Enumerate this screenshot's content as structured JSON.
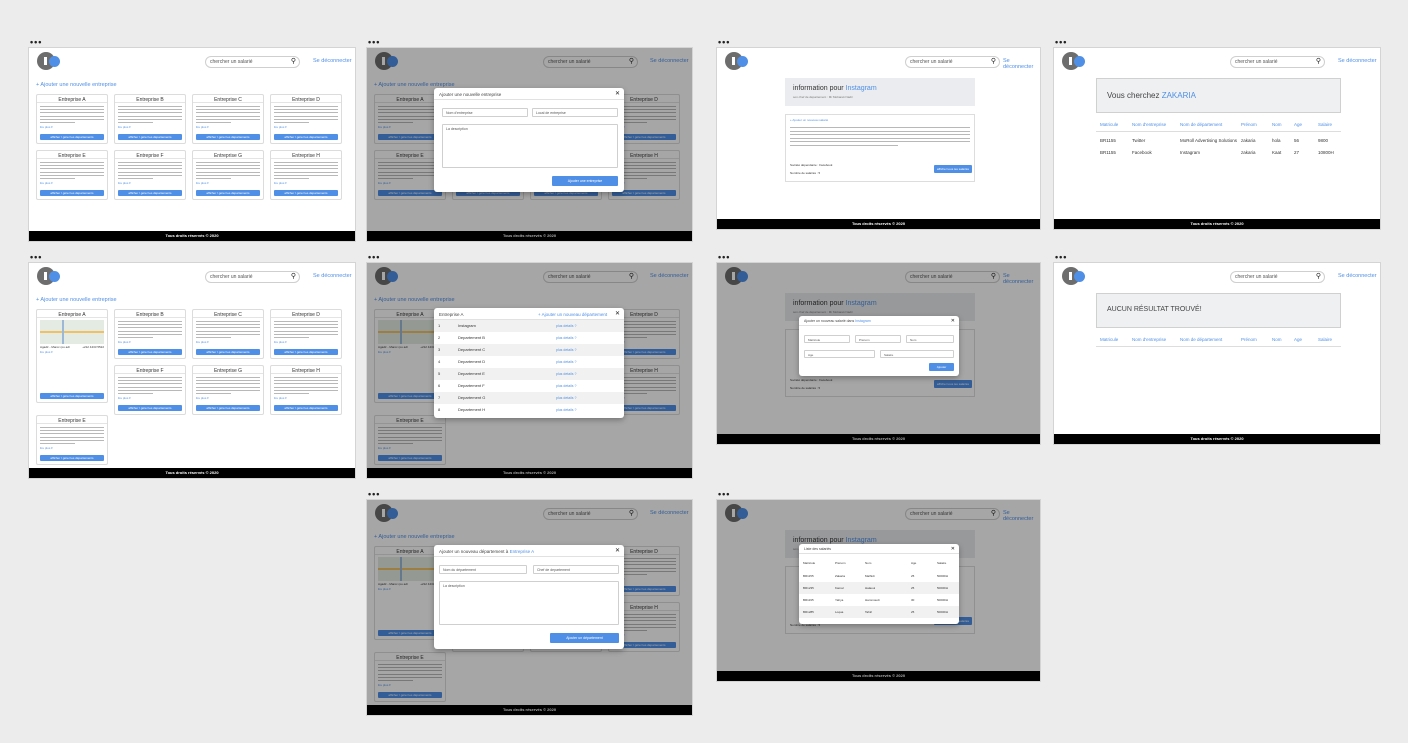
{
  "header": {
    "search_placeholder": "chercher un salarié",
    "logout": "Se déconnecter"
  },
  "footer": "Tous droits réservés © 2020",
  "dots": "•••",
  "add_company": "+ Ajouter une nouvelle entreprise",
  "companies": [
    "Entreprise A",
    "Entreprise B",
    "Entreprise C",
    "Entreprise D",
    "Entreprise E",
    "Entreprise F",
    "Entreprise G",
    "Entreprise H"
  ],
  "card_more": "lire plus ▾",
  "card_button": "afficher / gérer les départements",
  "map_caption": "Agadir - Maroc (ou adr",
  "map_phone": "+212 4433 5522",
  "modal_add_company": {
    "title": "Ajouter une nouvelle entreprise",
    "name": "Nom d'entreprise",
    "location": "Local de entreprise",
    "description": "La description",
    "button": "Ajouter une entreprise"
  },
  "modal_departments": {
    "title": "Entreprise A",
    "add": "+ Ajouter un nouveau département",
    "rows": [
      {
        "n": "1",
        "name": "Instagram",
        "link": "plus details ?"
      },
      {
        "n": "2",
        "name": "Departement B",
        "link": "plus details ?"
      },
      {
        "n": "3",
        "name": "Departement C",
        "link": "plus details ?"
      },
      {
        "n": "4",
        "name": "Departement D",
        "link": "plus details ?"
      },
      {
        "n": "5",
        "name": "Departement E",
        "link": "plus details ?"
      },
      {
        "n": "6",
        "name": "Departement F",
        "link": "plus details ?"
      },
      {
        "n": "7",
        "name": "Departement G",
        "link": "plus details ?"
      },
      {
        "n": "8",
        "name": "Departement H",
        "link": "plus details ?"
      }
    ]
  },
  "modal_add_dept": {
    "title_prefix": "Ajouter un nouveau département à ",
    "title_company": "Entreprise A",
    "name": "Nom du département",
    "chief": "Chef de departement",
    "description": "La description",
    "button": "Ajouter un département"
  },
  "info": {
    "prefix": "information pour ",
    "name": "Instagram",
    "sub": "son chef de département : Mr Mobarek Nadir",
    "addline": "+ Ajouter un nouveau salarié",
    "footline": "Société dépendante : Facebook",
    "button": "afficher tous les salariés",
    "count": "Nombre de salariés : 5"
  },
  "modal_add_employee": {
    "title_prefix": "Ajouter un nouveau salarié dans ",
    "title_company": "Instagram",
    "fields": [
      "Matricule",
      "Prénom",
      "Nom",
      "Age",
      "Salaire"
    ],
    "button": "Ajouter"
  },
  "modal_employees": {
    "title": "Liste des salariés",
    "headers": [
      "Matricule",
      "Prénom",
      "Nom",
      "Age",
      "Salaire"
    ],
    "rows": [
      [
        "BR1155",
        "Zakaria",
        "Malhidi",
        "25",
        "5000DH"
      ],
      [
        "BR1235",
        "Kamal",
        "Halaoui",
        "25",
        "5000DH"
      ],
      [
        "BR1195",
        "Yahya",
        "Hammoudi",
        "30",
        "5000DH"
      ],
      [
        "BR1285",
        "Loqua",
        "Tahiri",
        "25",
        "5000DH"
      ]
    ]
  },
  "search_result": {
    "prefix": "Vous cherchez ",
    "term": "ZAKARIA",
    "headers": [
      "Matricule",
      "Nom d'entreprise",
      "Nom de département",
      "Prénom",
      "Nom",
      "Age",
      "Salaire"
    ],
    "rows": [
      [
        "BR1155",
        "Twitter",
        "MoRoll Advertising Solutions",
        "zakaria",
        "hola",
        "56",
        "9800"
      ],
      [
        "BR1155",
        "Facebook",
        "Instagram",
        "zakaria",
        "Kaat",
        "27",
        "10800H"
      ]
    ]
  },
  "no_result": "AUCUN RÉSULTAT TROUVÉ!"
}
